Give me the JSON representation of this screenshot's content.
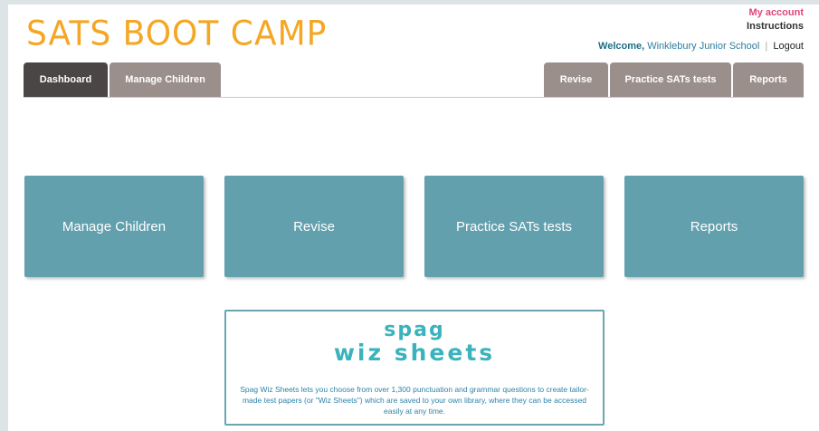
{
  "brand": {
    "logo_text": "SATS BOOT CAMP"
  },
  "header": {
    "my_account": "My account",
    "instructions": "Instructions",
    "welcome_label": "Welcome,",
    "school": "Winklebury Junior School",
    "separator": "|",
    "logout": "Logout"
  },
  "nav": {
    "left_tabs": [
      {
        "label": "Dashboard",
        "active": true
      },
      {
        "label": "Manage Children",
        "active": false
      }
    ],
    "right_tabs": [
      {
        "label": "Revise"
      },
      {
        "label": "Practice SATs tests"
      },
      {
        "label": "Reports"
      }
    ]
  },
  "tiles": [
    {
      "label": "Manage Children"
    },
    {
      "label": "Revise"
    },
    {
      "label": "Practice SATs tests"
    },
    {
      "label": "Reports"
    }
  ],
  "promo": {
    "logo_line1": "spag",
    "logo_line2": "wiz sheets",
    "description": "Spag Wiz Sheets lets you choose from over 1,300 punctuation and grammar questions to create tailor-made test papers (or \"Wiz Sheets\") which are saved to your own library, where they can be accessed easily at any time."
  },
  "colors": {
    "logo": "#f5a623",
    "tile": "#62a0ae",
    "tab_active": "#4a4646",
    "tab_inactive": "#9b8f8b",
    "account_link": "#e0457b"
  }
}
